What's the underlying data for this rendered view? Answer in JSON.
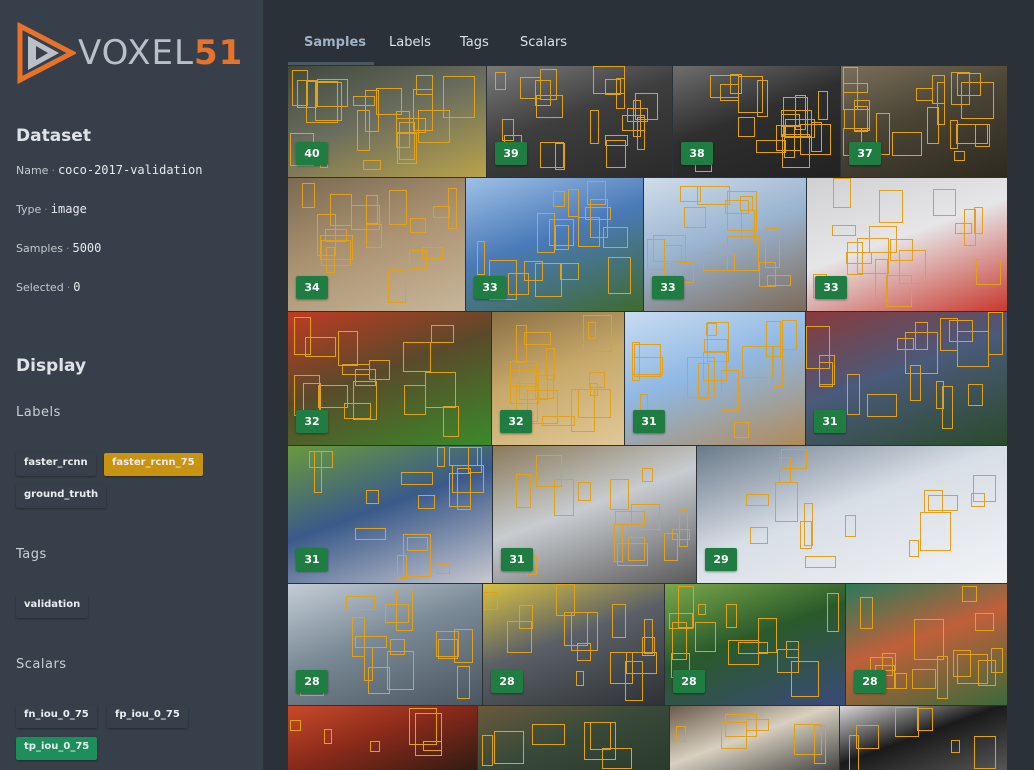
{
  "brand": {
    "word_left": "VOXEL",
    "word_right": "51"
  },
  "dataset": {
    "title": "Dataset",
    "rows": [
      {
        "label": "Name",
        "value": "coco-2017-validation"
      },
      {
        "label": "Type",
        "value": "image"
      },
      {
        "label": "Samples",
        "value": "5000"
      },
      {
        "label": "Selected",
        "value": "0"
      }
    ]
  },
  "display": {
    "title": "Display",
    "labels_title": "Labels",
    "labels": [
      {
        "text": "faster_rcnn",
        "color": "#1d9a5c",
        "style": "outline"
      },
      {
        "text": "faster_rcnn_75",
        "color": "#c99312",
        "style": "filled"
      },
      {
        "text": "ground_truth",
        "color": "#1d8f6e",
        "style": "outline"
      }
    ],
    "tags_title": "Tags",
    "tags": [
      {
        "text": "validation",
        "color": "#8a939c",
        "style": "outline"
      }
    ],
    "scalars_title": "Scalars",
    "scalars": [
      {
        "text": "fn_iou_0_75",
        "color": "#d12a8c",
        "style": "outline"
      },
      {
        "text": "fp_iou_0_75",
        "color": "#2f9a3c",
        "style": "outline"
      },
      {
        "text": "tp_iou_0_75",
        "color": "#1d8f5a",
        "style": "filled"
      }
    ]
  },
  "tabs": [
    "Samples",
    "Labels",
    "Tags",
    "Scalars"
  ],
  "active_tab": "Samples",
  "samples": [
    {
      "count": "40",
      "scene": "crowd-umbrellas",
      "colors": [
        "#6a6d5e",
        "#3f4a3c",
        "#b8a24a"
      ]
    },
    {
      "count": "39",
      "scene": "class-photo",
      "colors": [
        "#3e3e3e",
        "#7a7a7a",
        "#2a2a2a"
      ]
    },
    {
      "count": "38",
      "scene": "class-photo",
      "colors": [
        "#2f2f2f",
        "#6e6e6e",
        "#222222"
      ]
    },
    {
      "count": "37",
      "scene": "sepia-group",
      "colors": [
        "#4a4435",
        "#7a705a",
        "#2e2a20"
      ]
    },
    {
      "count": "34",
      "scene": "elephants",
      "colors": [
        "#a99170",
        "#7a6a52",
        "#c7b699"
      ]
    },
    {
      "count": "33",
      "scene": "kites-sky",
      "colors": [
        "#4a7ab8",
        "#9ec0e6",
        "#3f6a2f"
      ]
    },
    {
      "count": "33",
      "scene": "kites-beach",
      "colors": [
        "#9ab4d0",
        "#cfdde9",
        "#7d6a58"
      ]
    },
    {
      "count": "33",
      "scene": "snow-sledding",
      "colors": [
        "#e6e6e8",
        "#d0d0d4",
        "#c8392e"
      ]
    },
    {
      "count": "32",
      "scene": "market",
      "colors": [
        "#5a4a2a",
        "#c03a22",
        "#3a8a2a"
      ]
    },
    {
      "count": "32",
      "scene": "sepia-beach",
      "colors": [
        "#c7a86a",
        "#8a7045",
        "#e0c896"
      ]
    },
    {
      "count": "31",
      "scene": "kites-beach",
      "colors": [
        "#8fb8e4",
        "#c8dcf0",
        "#b08a5a"
      ]
    },
    {
      "count": "31",
      "scene": "crowd-kids",
      "colors": [
        "#4a5a7a",
        "#8a3a3a",
        "#2a4a2a"
      ]
    },
    {
      "count": "31",
      "scene": "baseball",
      "colors": [
        "#3a5a8a",
        "#6a9a3a",
        "#c8c8d0"
      ]
    },
    {
      "count": "31",
      "scene": "parliament",
      "colors": [
        "#c8ccd0",
        "#8a7a5a",
        "#5a5a5a"
      ]
    },
    {
      "count": "29",
      "scene": "ski-slope",
      "colors": [
        "#d8dee6",
        "#6a7a8a",
        "#f2f4f6"
      ]
    },
    {
      "count": "28",
      "scene": "surf",
      "colors": [
        "#7a8a96",
        "#c4cdd6",
        "#4a5660"
      ]
    },
    {
      "count": "28",
      "scene": "street",
      "colors": [
        "#5a6066",
        "#d8c040",
        "#2e3236"
      ]
    },
    {
      "count": "28",
      "scene": "baseball",
      "colors": [
        "#2a5a2a",
        "#7aa84a",
        "#3a4a7a"
      ]
    },
    {
      "count": "28",
      "scene": "tennis",
      "colors": [
        "#c0603a",
        "#2a7a5a",
        "#3a6a3a"
      ]
    },
    {
      "count": "",
      "scene": "restaurant",
      "colors": [
        "#8a2a1a",
        "#c84a2a",
        "#2a1a12"
      ]
    },
    {
      "count": "",
      "scene": "dinner",
      "colors": [
        "#3a4a3a",
        "#6a5a3a",
        "#2a3a2a"
      ]
    },
    {
      "count": "",
      "scene": "room",
      "colors": [
        "#d8d0c0",
        "#6a5a4a",
        "#3a3a3a"
      ]
    },
    {
      "count": "",
      "scene": "bedroom",
      "colors": [
        "#1a1a1a",
        "#d8d8d8",
        "#5a5a5a"
      ]
    }
  ]
}
